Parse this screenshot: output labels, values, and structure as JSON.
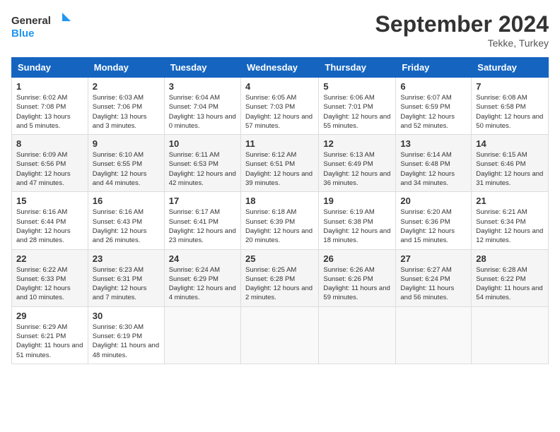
{
  "header": {
    "logo_general": "General",
    "logo_blue": "Blue",
    "title": "September 2024",
    "location": "Tekke, Turkey"
  },
  "days_of_week": [
    "Sunday",
    "Monday",
    "Tuesday",
    "Wednesday",
    "Thursday",
    "Friday",
    "Saturday"
  ],
  "weeks": [
    [
      {
        "day": "1",
        "sunrise": "6:02 AM",
        "sunset": "7:08 PM",
        "daylight": "13 hours and 5 minutes"
      },
      {
        "day": "2",
        "sunrise": "6:03 AM",
        "sunset": "7:06 PM",
        "daylight": "13 hours and 3 minutes"
      },
      {
        "day": "3",
        "sunrise": "6:04 AM",
        "sunset": "7:04 PM",
        "daylight": "13 hours and 0 minutes"
      },
      {
        "day": "4",
        "sunrise": "6:05 AM",
        "sunset": "7:03 PM",
        "daylight": "12 hours and 57 minutes"
      },
      {
        "day": "5",
        "sunrise": "6:06 AM",
        "sunset": "7:01 PM",
        "daylight": "12 hours and 55 minutes"
      },
      {
        "day": "6",
        "sunrise": "6:07 AM",
        "sunset": "6:59 PM",
        "daylight": "12 hours and 52 minutes"
      },
      {
        "day": "7",
        "sunrise": "6:08 AM",
        "sunset": "6:58 PM",
        "daylight": "12 hours and 50 minutes"
      }
    ],
    [
      {
        "day": "8",
        "sunrise": "6:09 AM",
        "sunset": "6:56 PM",
        "daylight": "12 hours and 47 minutes"
      },
      {
        "day": "9",
        "sunrise": "6:10 AM",
        "sunset": "6:55 PM",
        "daylight": "12 hours and 44 minutes"
      },
      {
        "day": "10",
        "sunrise": "6:11 AM",
        "sunset": "6:53 PM",
        "daylight": "12 hours and 42 minutes"
      },
      {
        "day": "11",
        "sunrise": "6:12 AM",
        "sunset": "6:51 PM",
        "daylight": "12 hours and 39 minutes"
      },
      {
        "day": "12",
        "sunrise": "6:13 AM",
        "sunset": "6:49 PM",
        "daylight": "12 hours and 36 minutes"
      },
      {
        "day": "13",
        "sunrise": "6:14 AM",
        "sunset": "6:48 PM",
        "daylight": "12 hours and 34 minutes"
      },
      {
        "day": "14",
        "sunrise": "6:15 AM",
        "sunset": "6:46 PM",
        "daylight": "12 hours and 31 minutes"
      }
    ],
    [
      {
        "day": "15",
        "sunrise": "6:16 AM",
        "sunset": "6:44 PM",
        "daylight": "12 hours and 28 minutes"
      },
      {
        "day": "16",
        "sunrise": "6:16 AM",
        "sunset": "6:43 PM",
        "daylight": "12 hours and 26 minutes"
      },
      {
        "day": "17",
        "sunrise": "6:17 AM",
        "sunset": "6:41 PM",
        "daylight": "12 hours and 23 minutes"
      },
      {
        "day": "18",
        "sunrise": "6:18 AM",
        "sunset": "6:39 PM",
        "daylight": "12 hours and 20 minutes"
      },
      {
        "day": "19",
        "sunrise": "6:19 AM",
        "sunset": "6:38 PM",
        "daylight": "12 hours and 18 minutes"
      },
      {
        "day": "20",
        "sunrise": "6:20 AM",
        "sunset": "6:36 PM",
        "daylight": "12 hours and 15 minutes"
      },
      {
        "day": "21",
        "sunrise": "6:21 AM",
        "sunset": "6:34 PM",
        "daylight": "12 hours and 12 minutes"
      }
    ],
    [
      {
        "day": "22",
        "sunrise": "6:22 AM",
        "sunset": "6:33 PM",
        "daylight": "12 hours and 10 minutes"
      },
      {
        "day": "23",
        "sunrise": "6:23 AM",
        "sunset": "6:31 PM",
        "daylight": "12 hours and 7 minutes"
      },
      {
        "day": "24",
        "sunrise": "6:24 AM",
        "sunset": "6:29 PM",
        "daylight": "12 hours and 4 minutes"
      },
      {
        "day": "25",
        "sunrise": "6:25 AM",
        "sunset": "6:28 PM",
        "daylight": "12 hours and 2 minutes"
      },
      {
        "day": "26",
        "sunrise": "6:26 AM",
        "sunset": "6:26 PM",
        "daylight": "11 hours and 59 minutes"
      },
      {
        "day": "27",
        "sunrise": "6:27 AM",
        "sunset": "6:24 PM",
        "daylight": "11 hours and 56 minutes"
      },
      {
        "day": "28",
        "sunrise": "6:28 AM",
        "sunset": "6:22 PM",
        "daylight": "11 hours and 54 minutes"
      }
    ],
    [
      {
        "day": "29",
        "sunrise": "6:29 AM",
        "sunset": "6:21 PM",
        "daylight": "11 hours and 51 minutes"
      },
      {
        "day": "30",
        "sunrise": "6:30 AM",
        "sunset": "6:19 PM",
        "daylight": "11 hours and 48 minutes"
      },
      null,
      null,
      null,
      null,
      null
    ]
  ]
}
